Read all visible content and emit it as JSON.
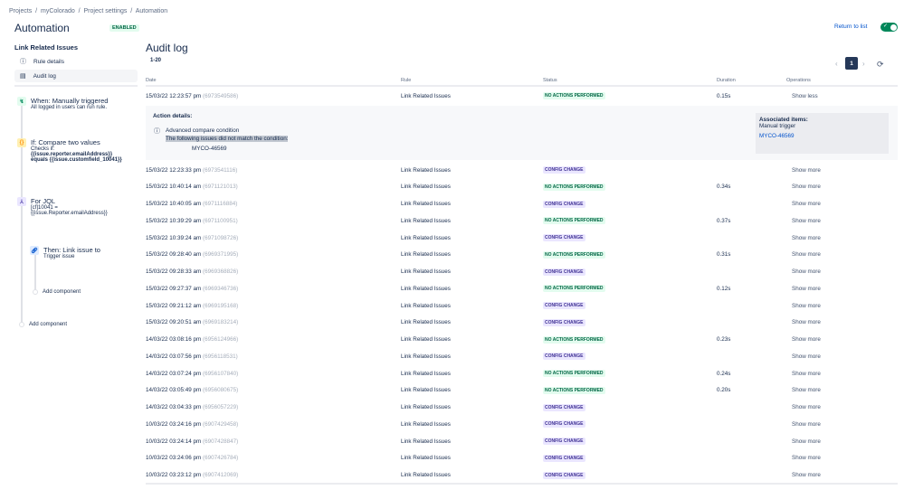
{
  "breadcrumbs": [
    "Projects",
    "myColorado",
    "Project settings",
    "Automation"
  ],
  "page_title": "Automation",
  "status_badge": "ENABLED",
  "rule": {
    "name": "Link Related Issues",
    "nav": [
      {
        "label": "Rule details",
        "icon": "info-icon"
      },
      {
        "label": "Audit log",
        "icon": "document-icon"
      }
    ]
  },
  "components": {
    "trigger": {
      "title": "When: Manually triggered",
      "sub": "All logged in users can run rule."
    },
    "condition": {
      "title": "If: Compare two values",
      "sub": "Checks if:",
      "expr1": "{{issue.reporter.emailAddress}}",
      "expr2": "equals {{issue.customfield_10041}}"
    },
    "branch": {
      "title": "For JQL",
      "sub1": "[cf]10041 =",
      "sub2": "{{issue.Reporter.emailAddress}}"
    },
    "action": {
      "title": "Then: Link issue to",
      "sub": "Trigger issue"
    },
    "add_inner": "Add component",
    "add_outer": "Add component"
  },
  "audit": {
    "title": "Audit log",
    "range": "1-20",
    "return_label": "Return to list",
    "page": "1",
    "columns": [
      "Date",
      "Rule",
      "Status",
      "Duration",
      "Operations"
    ],
    "details": {
      "heading": "Action details:",
      "condition": "Advanced compare condition",
      "message": "The following issues did not match the condition:",
      "issue": "MYCO-46569",
      "assoc_heading": "Associated items:",
      "assoc_trigger": "Manual trigger",
      "assoc_issue": "MYCO-46569"
    },
    "rows": [
      {
        "date": "15/03/22 12:23:57 pm",
        "id": "(6973549586)",
        "rule": "Link Related Issues",
        "status": "NO ACTIONS PERFORMED",
        "duration": "0.15s",
        "op": "Show less"
      },
      {
        "date": "15/03/22 12:23:33 pm",
        "id": "(6973541116)",
        "rule": "Link Related Issues",
        "status": "CONFIG CHANGE",
        "duration": "",
        "op": "Show more"
      },
      {
        "date": "15/03/22 10:40:14 am",
        "id": "(6971121013)",
        "rule": "Link Related Issues",
        "status": "NO ACTIONS PERFORMED",
        "duration": "0.34s",
        "op": "Show more"
      },
      {
        "date": "15/03/22 10:40:05 am",
        "id": "(6971116884)",
        "rule": "Link Related Issues",
        "status": "CONFIG CHANGE",
        "duration": "",
        "op": "Show more"
      },
      {
        "date": "15/03/22 10:39:29 am",
        "id": "(6971100951)",
        "rule": "Link Related Issues",
        "status": "NO ACTIONS PERFORMED",
        "duration": "0.37s",
        "op": "Show more"
      },
      {
        "date": "15/03/22 10:39:24 am",
        "id": "(6971098726)",
        "rule": "Link Related Issues",
        "status": "CONFIG CHANGE",
        "duration": "",
        "op": "Show more"
      },
      {
        "date": "15/03/22 09:28:40 am",
        "id": "(6969371995)",
        "rule": "Link Related Issues",
        "status": "NO ACTIONS PERFORMED",
        "duration": "0.31s",
        "op": "Show more"
      },
      {
        "date": "15/03/22 09:28:33 am",
        "id": "(6969368826)",
        "rule": "Link Related Issues",
        "status": "CONFIG CHANGE",
        "duration": "",
        "op": "Show more"
      },
      {
        "date": "15/03/22 09:27:37 am",
        "id": "(6969346736)",
        "rule": "Link Related Issues",
        "status": "NO ACTIONS PERFORMED",
        "duration": "0.12s",
        "op": "Show more"
      },
      {
        "date": "15/03/22 09:21:12 am",
        "id": "(6969195168)",
        "rule": "Link Related Issues",
        "status": "CONFIG CHANGE",
        "duration": "",
        "op": "Show more"
      },
      {
        "date": "15/03/22 09:20:51 am",
        "id": "(6969183214)",
        "rule": "Link Related Issues",
        "status": "CONFIG CHANGE",
        "duration": "",
        "op": "Show more"
      },
      {
        "date": "14/03/22 03:08:16 pm",
        "id": "(6956124966)",
        "rule": "Link Related Issues",
        "status": "NO ACTIONS PERFORMED",
        "duration": "0.23s",
        "op": "Show more"
      },
      {
        "date": "14/03/22 03:07:56 pm",
        "id": "(6956118531)",
        "rule": "Link Related Issues",
        "status": "CONFIG CHANGE",
        "duration": "",
        "op": "Show more"
      },
      {
        "date": "14/03/22 03:07:24 pm",
        "id": "(6956107840)",
        "rule": "Link Related Issues",
        "status": "NO ACTIONS PERFORMED",
        "duration": "0.24s",
        "op": "Show more"
      },
      {
        "date": "14/03/22 03:05:49 pm",
        "id": "(6956080675)",
        "rule": "Link Related Issues",
        "status": "NO ACTIONS PERFORMED",
        "duration": "0.20s",
        "op": "Show more"
      },
      {
        "date": "14/03/22 03:04:33 pm",
        "id": "(6956057229)",
        "rule": "Link Related Issues",
        "status": "CONFIG CHANGE",
        "duration": "",
        "op": "Show more"
      },
      {
        "date": "10/03/22 03:24:16 pm",
        "id": "(6907429458)",
        "rule": "Link Related Issues",
        "status": "CONFIG CHANGE",
        "duration": "",
        "op": "Show more"
      },
      {
        "date": "10/03/22 03:24:14 pm",
        "id": "(6907428847)",
        "rule": "Link Related Issues",
        "status": "CONFIG CHANGE",
        "duration": "",
        "op": "Show more"
      },
      {
        "date": "10/03/22 03:24:06 pm",
        "id": "(6907426784)",
        "rule": "Link Related Issues",
        "status": "CONFIG CHANGE",
        "duration": "",
        "op": "Show more"
      },
      {
        "date": "10/03/22 03:23:12 pm",
        "id": "(6907412069)",
        "rule": "Link Related Issues",
        "status": "CONFIG CHANGE",
        "duration": "",
        "op": "Show more"
      }
    ]
  }
}
